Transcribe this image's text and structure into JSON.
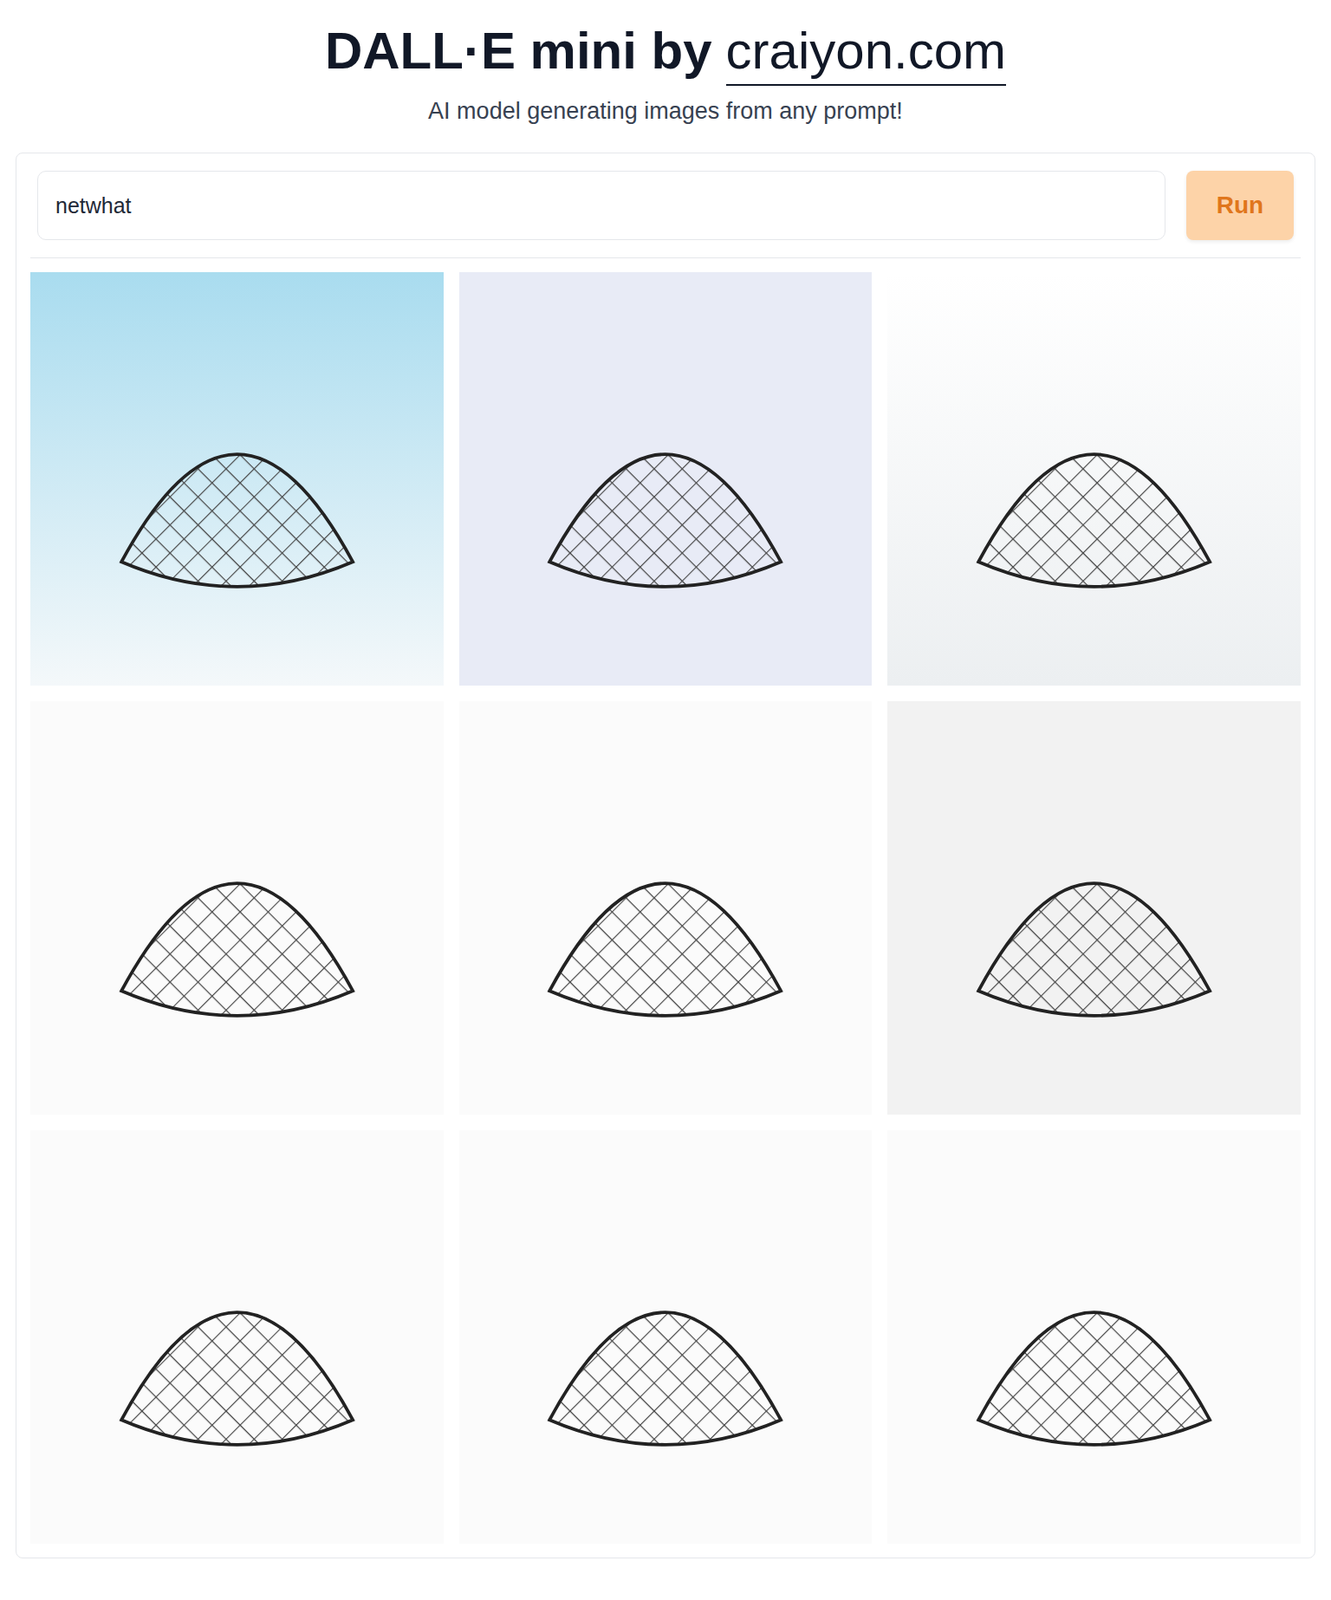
{
  "header": {
    "title": "DALL·E mini by",
    "link": "craiyon.com",
    "subtitle": "AI model generating images from any prompt!"
  },
  "prompt": {
    "value": "netwhat"
  },
  "buttons": [
    "Run"
  ],
  "images": [
    {
      "kind": "image"
    },
    {
      "kind": "image"
    },
    {
      "kind": "image"
    },
    {
      "kind": "image"
    },
    {
      "kind": "image"
    },
    {
      "kind": "image"
    },
    {
      "kind": "image"
    },
    {
      "kind": "image"
    },
    {
      "kind": "image"
    }
  ]
}
